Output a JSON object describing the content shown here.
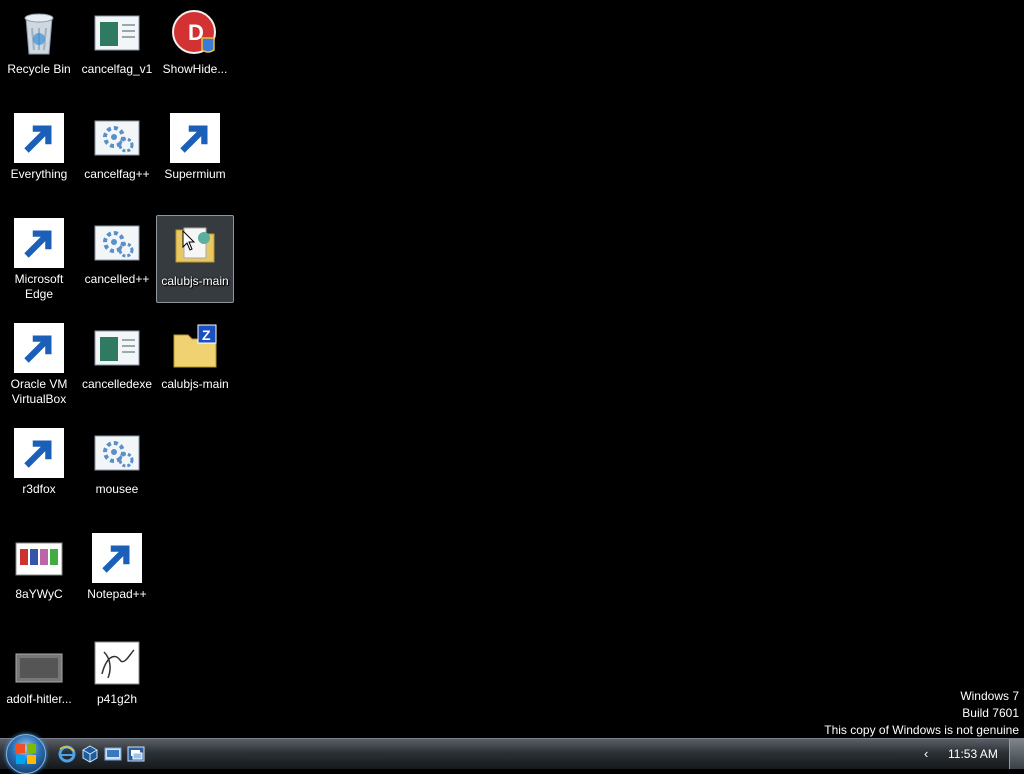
{
  "desktop": {
    "icons": [
      {
        "label": "Recycle Bin"
      },
      {
        "label": "cancelfag_v1"
      },
      {
        "label": "ShowHide..."
      },
      {
        "label": "Everything"
      },
      {
        "label": "cancelfag++"
      },
      {
        "label": "Supermium"
      },
      {
        "label": "Microsoft\nEdge"
      },
      {
        "label": "cancelled++"
      },
      {
        "label": "calubjs-main"
      },
      {
        "label": "Oracle VM\nVirtualBox"
      },
      {
        "label": "cancelledexe"
      },
      {
        "label": "calubjs-main"
      },
      {
        "label": "r3dfox"
      },
      {
        "label": "mousee"
      },
      {
        "label": "8aYWyC"
      },
      {
        "label": "Notepad++"
      },
      {
        "label": "adolf-hitler..."
      },
      {
        "label": "p41g2h"
      }
    ]
  },
  "watermark": {
    "line1": "Windows 7",
    "line2": "Build 7601",
    "line3": "This copy of Windows is not genuine"
  },
  "taskbar": {
    "tray_arrow": "‹",
    "clock": "11:53 AM"
  }
}
